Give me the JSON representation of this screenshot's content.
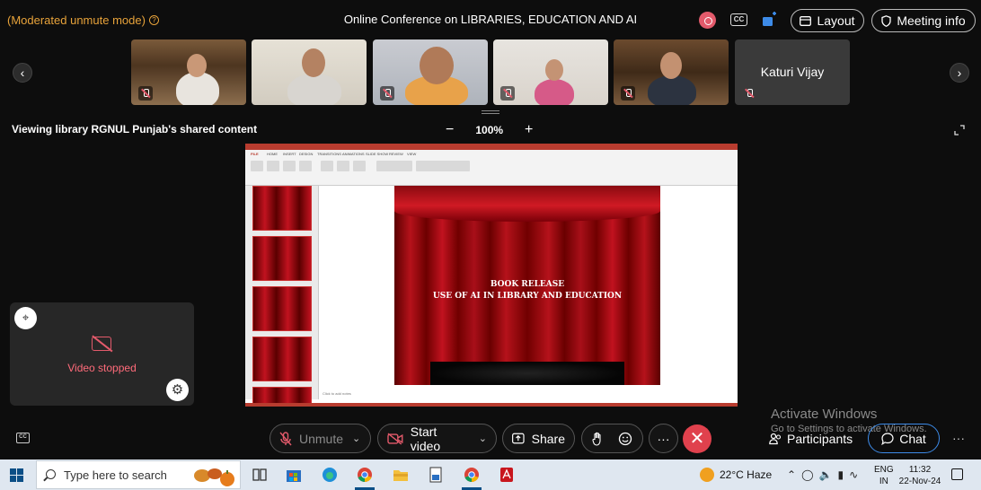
{
  "header": {
    "mode_text": "(Moderated unmute mode)",
    "mode_info": "?",
    "title": "Online Conference on LIBRARIES, EDUCATION AND AI",
    "cc_label": "CC",
    "layout_label": "Layout",
    "meeting_info_label": "Meeting info"
  },
  "filmstrip": {
    "prev_label": "‹",
    "next_label": "›",
    "name_tile": "Katuri Vijay"
  },
  "content": {
    "viewing_label": "Viewing library RGNUL Punjab's shared content",
    "zoom_minus": "−",
    "zoom_level": "100%",
    "zoom_plus": "+"
  },
  "slide": {
    "line1": "BOOK RELEASE",
    "line2": "USE OF AI IN LIBRARY AND EDUCATION",
    "notes": "Click to add notes"
  },
  "self_view": {
    "status": "Video stopped",
    "gear": "⚙"
  },
  "watermark": {
    "title": "Activate Windows",
    "sub": "Go to Settings to activate Windows."
  },
  "controls": {
    "unmute": "Unmute",
    "start_video": "Start video",
    "share": "Share",
    "more": "···",
    "leave": "✕",
    "participants": "Participants",
    "chat": "Chat",
    "overflow": "···",
    "captions": "CC"
  },
  "taskbar": {
    "search_placeholder": "Type here to search",
    "weather": "22°C  Haze",
    "lang_line1": "ENG",
    "lang_line2": "IN",
    "time": "11:32",
    "date": "22-Nov-24"
  },
  "colors": {
    "accent_blue": "#3d8be8",
    "leave_red": "#e0414d",
    "mode_orange": "#e8a33a"
  }
}
